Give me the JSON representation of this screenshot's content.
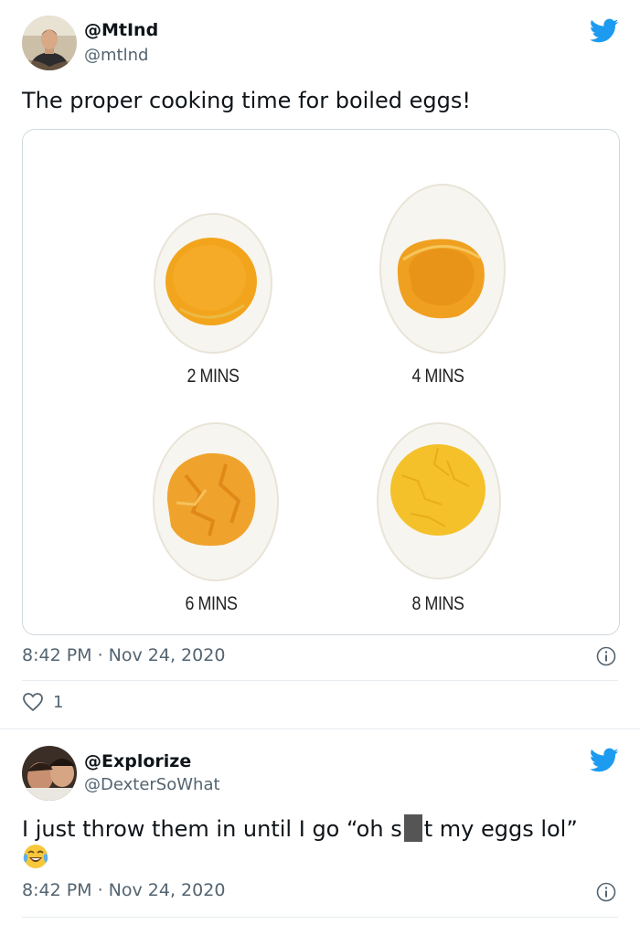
{
  "tweets": [
    {
      "name": "@MtInd",
      "handle": "@mtlnd",
      "text": "The proper cooking time for boiled eggs!",
      "media": {
        "labels": [
          "2 MINS",
          "4 MINS",
          "6 MINS",
          "8 MINS"
        ]
      },
      "timestamp": "8:42 PM · Nov 24, 2020",
      "likes": "1"
    },
    {
      "name": "@Explorize",
      "handle": "@DexterSoWhat",
      "text_before": "I just throw them in until I go “oh s",
      "text_after": "t my eggs lol”",
      "emoji": "face-with-tears-of-joy",
      "timestamp": "8:42 PM · Nov 24, 2020"
    }
  ],
  "colors": {
    "twitter_blue": "#1d9bf0",
    "secondary_text": "#536471",
    "border": "#cfd9de"
  }
}
